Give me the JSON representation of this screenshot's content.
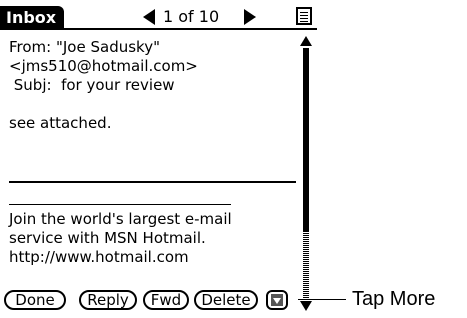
{
  "header": {
    "title": "Inbox",
    "counter": "1 of 10"
  },
  "message": {
    "lines": [
      "From: \"Joe Sadusky\"",
      "<jms510@hotmail.com>",
      " Subj:  for your review",
      "",
      "see attached."
    ],
    "footer_lines": [
      "Join the world's largest e-mail",
      "service with MSN Hotmail.",
      "http://www.hotmail.com"
    ]
  },
  "buttons": {
    "done": "Done",
    "reply": "Reply",
    "fwd": "Fwd",
    "delete": "Delete"
  },
  "callout": "Tap More",
  "icons": {
    "prev": "left-arrow-icon",
    "next": "right-arrow-icon",
    "menu": "menu-icon",
    "more": "more-icon"
  }
}
